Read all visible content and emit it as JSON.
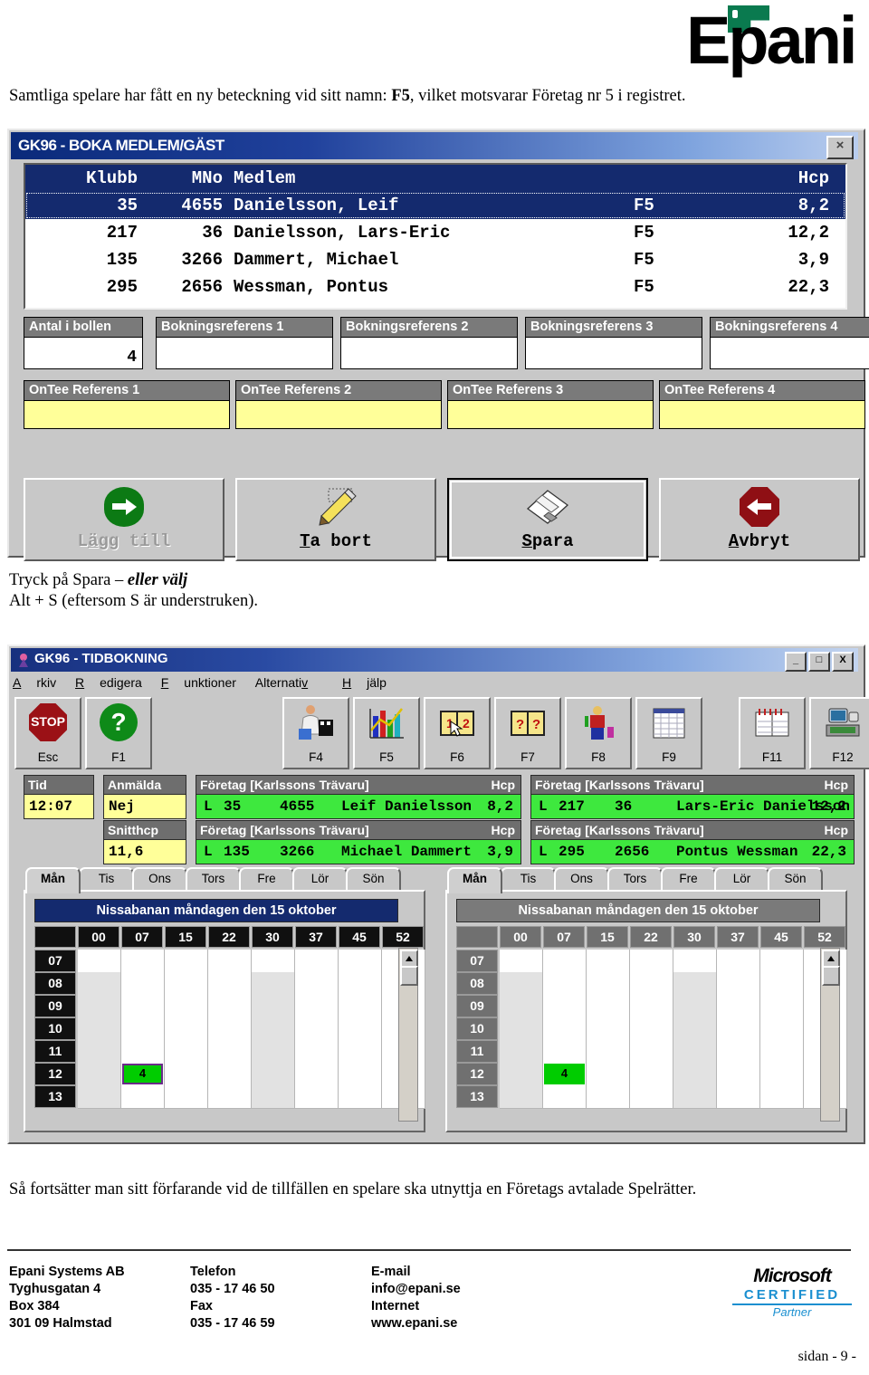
{
  "header": {
    "logo_text": "Epani",
    "intro_before": "Samtliga spelare har fått en ny beteckning vid sitt namn: ",
    "intro_bold": "F5",
    "intro_after": ", vilket motsvarar Företag nr 5 i registret."
  },
  "boka_window": {
    "title": "GK96 - BOKA MEDLEM/GÄST",
    "close_label": "×",
    "columns": {
      "klubb": "Klubb",
      "mno": "MNo",
      "medlem": "Medlem",
      "tag": "",
      "hcp": "Hcp"
    },
    "rows": [
      {
        "klubb": "35",
        "mno": "4655",
        "medlem": "Danielsson, Leif",
        "tag": "F5",
        "hcp": "8,2",
        "selected": true
      },
      {
        "klubb": "217",
        "mno": "36",
        "medlem": "Danielsson, Lars-Eric",
        "tag": "F5",
        "hcp": "12,2",
        "selected": false
      },
      {
        "klubb": "135",
        "mno": "3266",
        "medlem": "Dammert, Michael",
        "tag": "F5",
        "hcp": "3,9",
        "selected": false
      },
      {
        "klubb": "295",
        "mno": "2656",
        "medlem": "Wessman, Pontus",
        "tag": "F5",
        "hcp": "22,3",
        "selected": false
      }
    ],
    "fields_row1": [
      {
        "label": "Antal i bollen",
        "value": "4"
      },
      {
        "label": "Bokningsreferens 1",
        "value": ""
      },
      {
        "label": "Bokningsreferens 2",
        "value": ""
      },
      {
        "label": "Bokningsreferens 3",
        "value": ""
      },
      {
        "label": "Bokningsreferens 4",
        "value": ""
      }
    ],
    "fields_row2": [
      {
        "label": "OnTee Referens 1",
        "value": ""
      },
      {
        "label": "OnTee Referens 2",
        "value": ""
      },
      {
        "label": "OnTee Referens 3",
        "value": ""
      },
      {
        "label": "OnTee Referens 4",
        "value": ""
      }
    ],
    "buttons": [
      {
        "label_pre": "L",
        "label_hot": "ä",
        "label_post": "gg till",
        "icon": "green-right-arrow-icon",
        "disabled": true,
        "default": false
      },
      {
        "label_pre": "",
        "label_hot": "T",
        "label_post": "a bort",
        "icon": "pencil-edit-icon",
        "disabled": false,
        "default": false
      },
      {
        "label_pre": "",
        "label_hot": "S",
        "label_post": "para",
        "icon": "floppy-disk-icon",
        "disabled": false,
        "default": true
      },
      {
        "label_pre": "",
        "label_hot": "A",
        "label_post": "vbryt",
        "icon": "red-left-arrow-icon",
        "disabled": false,
        "default": false
      }
    ]
  },
  "mid_note": {
    "line1_pre": "Tryck på Spara – ",
    "line1_bold": "eller välj",
    "line2": "Alt + S (eftersom S är understruken)."
  },
  "tid_window": {
    "title": "GK96 - TIDBOKNING",
    "window_buttons": [
      "_",
      "□",
      "X"
    ],
    "menu": [
      "Arkiv",
      "Redigera",
      "Funktioner",
      "Alternativ",
      "Hjälp"
    ],
    "toolbar": [
      {
        "key": "Esc",
        "icon": "stop-sign-icon"
      },
      {
        "key": "F1",
        "icon": "green-question-mark-icon"
      },
      {
        "key": "F4",
        "icon": "person-at-counter-icon"
      },
      {
        "key": "F5",
        "icon": "bar-chart-icon"
      },
      {
        "key": "F6",
        "icon": "book-1-2-icon"
      },
      {
        "key": "F7",
        "icon": "book-question-icon"
      },
      {
        "key": "F8",
        "icon": "greenkeeper-person-icon"
      },
      {
        "key": "F9",
        "icon": "spreadsheet-table-icon"
      },
      {
        "key": "F11",
        "icon": "calendar-icon"
      },
      {
        "key": "F12",
        "icon": "computer-printer-icon"
      }
    ],
    "info": {
      "tid_label": "Tid",
      "tid_value": "12:07",
      "anmalda_label": "Anmälda",
      "anmalda_value": "Nej",
      "snitthcp_label": "Snitthcp",
      "snitthcp_value": "11,6",
      "company_caption": "Företag [Karlssons Trävaru]",
      "hcp_caption": "Hcp",
      "players": [
        {
          "mark": "L",
          "klubb": "35",
          "mno": "4655",
          "name": "Leif Danielsson",
          "hcp": "8,2"
        },
        {
          "mark": "L",
          "klubb": "217",
          "mno": "36",
          "name": "Lars-Eric Danielsson",
          "hcp": "12,2"
        },
        {
          "mark": "L",
          "klubb": "135",
          "mno": "3266",
          "name": "Michael Dammert",
          "hcp": "3,9"
        },
        {
          "mark": "L",
          "klubb": "295",
          "mno": "2656",
          "name": "Pontus Wessman",
          "hcp": "22,3"
        }
      ]
    },
    "calendar": {
      "tabs": [
        "Mån",
        "Tis",
        "Ons",
        "Tors",
        "Fre",
        "Lör",
        "Sön"
      ],
      "active_tab": "Mån",
      "day_title": "Nissabanan måndagen den 15 oktober",
      "minute_columns": [
        "00",
        "07",
        "15",
        "22",
        "30",
        "37",
        "45",
        "52"
      ],
      "hour_rows": [
        "07",
        "08",
        "09",
        "10",
        "11",
        "12",
        "13"
      ],
      "booking": {
        "hour": "12",
        "minute": "07",
        "count": "4"
      }
    }
  },
  "closing_text": "Så fortsätter man sitt förfarande vid de tillfällen en spelare ska utnyttja en Företags avtalade Spelrätter.",
  "footer": {
    "col1": [
      "Epani Systems AB",
      "Tyghusgatan 4",
      "Box 384",
      "301 09  Halmstad"
    ],
    "col2": [
      "Telefon",
      "035 - 17 46 50",
      "Fax",
      "035 - 17 46 59"
    ],
    "col3": [
      "E-mail",
      "info@epani.se",
      "Internet",
      "www.epani.se"
    ],
    "ms_word": "Microsoft",
    "ms_cert": "CERTIFIED",
    "ms_partner": "Partner",
    "page_number": "sidan - 9 -"
  },
  "colors": {
    "title_blue": "#142a6e",
    "face": "#c8c8c8",
    "yellow": "#ffff99",
    "green": "#3ee83e",
    "booking_green": "#00cc00",
    "epani_green": "#0a7a4f",
    "ms_blue": "#1a8fd0"
  }
}
